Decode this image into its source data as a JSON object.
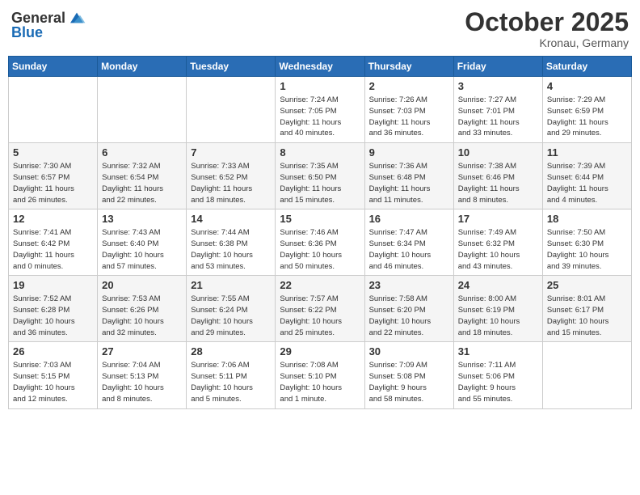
{
  "header": {
    "logo_general": "General",
    "logo_blue": "Blue",
    "month": "October 2025",
    "location": "Kronau, Germany"
  },
  "weekdays": [
    "Sunday",
    "Monday",
    "Tuesday",
    "Wednesday",
    "Thursday",
    "Friday",
    "Saturday"
  ],
  "weeks": [
    [
      {
        "day": "",
        "info": ""
      },
      {
        "day": "",
        "info": ""
      },
      {
        "day": "",
        "info": ""
      },
      {
        "day": "1",
        "info": "Sunrise: 7:24 AM\nSunset: 7:05 PM\nDaylight: 11 hours\nand 40 minutes."
      },
      {
        "day": "2",
        "info": "Sunrise: 7:26 AM\nSunset: 7:03 PM\nDaylight: 11 hours\nand 36 minutes."
      },
      {
        "day": "3",
        "info": "Sunrise: 7:27 AM\nSunset: 7:01 PM\nDaylight: 11 hours\nand 33 minutes."
      },
      {
        "day": "4",
        "info": "Sunrise: 7:29 AM\nSunset: 6:59 PM\nDaylight: 11 hours\nand 29 minutes."
      }
    ],
    [
      {
        "day": "5",
        "info": "Sunrise: 7:30 AM\nSunset: 6:57 PM\nDaylight: 11 hours\nand 26 minutes."
      },
      {
        "day": "6",
        "info": "Sunrise: 7:32 AM\nSunset: 6:54 PM\nDaylight: 11 hours\nand 22 minutes."
      },
      {
        "day": "7",
        "info": "Sunrise: 7:33 AM\nSunset: 6:52 PM\nDaylight: 11 hours\nand 18 minutes."
      },
      {
        "day": "8",
        "info": "Sunrise: 7:35 AM\nSunset: 6:50 PM\nDaylight: 11 hours\nand 15 minutes."
      },
      {
        "day": "9",
        "info": "Sunrise: 7:36 AM\nSunset: 6:48 PM\nDaylight: 11 hours\nand 11 minutes."
      },
      {
        "day": "10",
        "info": "Sunrise: 7:38 AM\nSunset: 6:46 PM\nDaylight: 11 hours\nand 8 minutes."
      },
      {
        "day": "11",
        "info": "Sunrise: 7:39 AM\nSunset: 6:44 PM\nDaylight: 11 hours\nand 4 minutes."
      }
    ],
    [
      {
        "day": "12",
        "info": "Sunrise: 7:41 AM\nSunset: 6:42 PM\nDaylight: 11 hours\nand 0 minutes."
      },
      {
        "day": "13",
        "info": "Sunrise: 7:43 AM\nSunset: 6:40 PM\nDaylight: 10 hours\nand 57 minutes."
      },
      {
        "day": "14",
        "info": "Sunrise: 7:44 AM\nSunset: 6:38 PM\nDaylight: 10 hours\nand 53 minutes."
      },
      {
        "day": "15",
        "info": "Sunrise: 7:46 AM\nSunset: 6:36 PM\nDaylight: 10 hours\nand 50 minutes."
      },
      {
        "day": "16",
        "info": "Sunrise: 7:47 AM\nSunset: 6:34 PM\nDaylight: 10 hours\nand 46 minutes."
      },
      {
        "day": "17",
        "info": "Sunrise: 7:49 AM\nSunset: 6:32 PM\nDaylight: 10 hours\nand 43 minutes."
      },
      {
        "day": "18",
        "info": "Sunrise: 7:50 AM\nSunset: 6:30 PM\nDaylight: 10 hours\nand 39 minutes."
      }
    ],
    [
      {
        "day": "19",
        "info": "Sunrise: 7:52 AM\nSunset: 6:28 PM\nDaylight: 10 hours\nand 36 minutes."
      },
      {
        "day": "20",
        "info": "Sunrise: 7:53 AM\nSunset: 6:26 PM\nDaylight: 10 hours\nand 32 minutes."
      },
      {
        "day": "21",
        "info": "Sunrise: 7:55 AM\nSunset: 6:24 PM\nDaylight: 10 hours\nand 29 minutes."
      },
      {
        "day": "22",
        "info": "Sunrise: 7:57 AM\nSunset: 6:22 PM\nDaylight: 10 hours\nand 25 minutes."
      },
      {
        "day": "23",
        "info": "Sunrise: 7:58 AM\nSunset: 6:20 PM\nDaylight: 10 hours\nand 22 minutes."
      },
      {
        "day": "24",
        "info": "Sunrise: 8:00 AM\nSunset: 6:19 PM\nDaylight: 10 hours\nand 18 minutes."
      },
      {
        "day": "25",
        "info": "Sunrise: 8:01 AM\nSunset: 6:17 PM\nDaylight: 10 hours\nand 15 minutes."
      }
    ],
    [
      {
        "day": "26",
        "info": "Sunrise: 7:03 AM\nSunset: 5:15 PM\nDaylight: 10 hours\nand 12 minutes."
      },
      {
        "day": "27",
        "info": "Sunrise: 7:04 AM\nSunset: 5:13 PM\nDaylight: 10 hours\nand 8 minutes."
      },
      {
        "day": "28",
        "info": "Sunrise: 7:06 AM\nSunset: 5:11 PM\nDaylight: 10 hours\nand 5 minutes."
      },
      {
        "day": "29",
        "info": "Sunrise: 7:08 AM\nSunset: 5:10 PM\nDaylight: 10 hours\nand 1 minute."
      },
      {
        "day": "30",
        "info": "Sunrise: 7:09 AM\nSunset: 5:08 PM\nDaylight: 9 hours\nand 58 minutes."
      },
      {
        "day": "31",
        "info": "Sunrise: 7:11 AM\nSunset: 5:06 PM\nDaylight: 9 hours\nand 55 minutes."
      },
      {
        "day": "",
        "info": ""
      }
    ]
  ]
}
